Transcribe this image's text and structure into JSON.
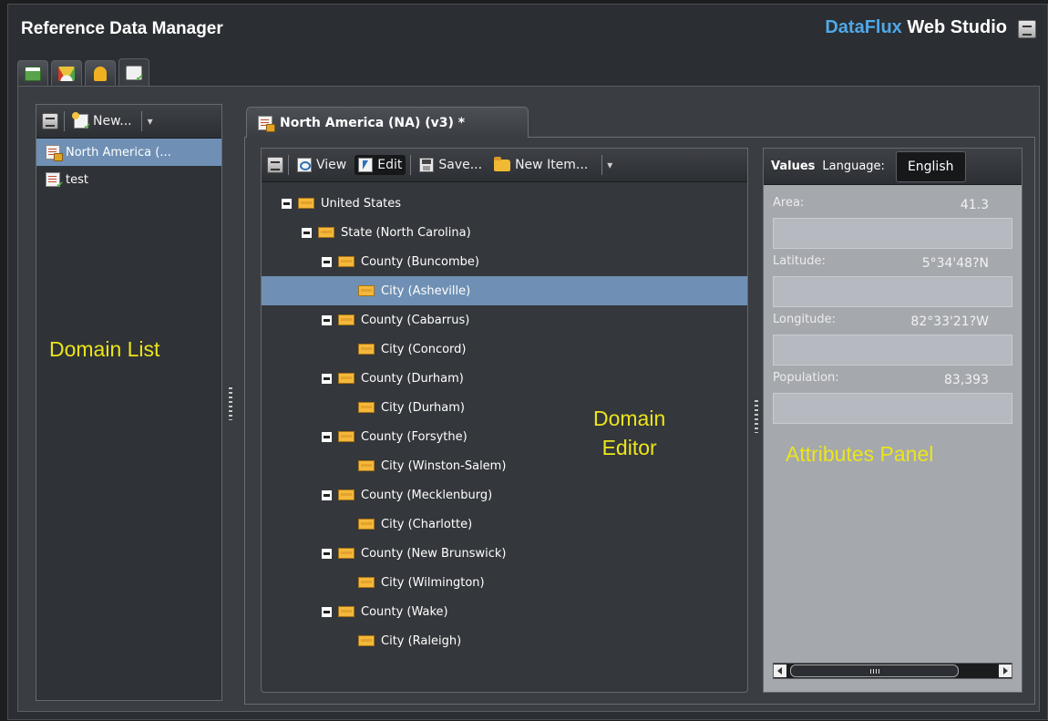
{
  "app": {
    "title": "Reference Data Manager",
    "brand_part1": "DataFlux",
    "brand_part2": "Web Studio",
    "tabs": [
      "window-icon",
      "gauge-icon",
      "bell-icon",
      "domain-doc-icon"
    ],
    "active_tab": 3
  },
  "domain_list": {
    "new_label": "New...",
    "items": [
      {
        "label": "North America (...",
        "icon": "locked-domain-icon",
        "selected": true
      },
      {
        "label": "test",
        "icon": "domain-icon",
        "selected": false
      }
    ],
    "annotation": "Domain List"
  },
  "domain_tab": {
    "title": "North America (NA) (v3) *"
  },
  "editor": {
    "toolbar": {
      "view_label": "View",
      "edit_label": "Edit",
      "save_label": "Save...",
      "new_item_label": "New Item..."
    },
    "annotation_line1": "Domain",
    "annotation_line2": "Editor",
    "tree": [
      {
        "label": "United States",
        "level": 0,
        "expanded": true
      },
      {
        "label": "State (North Carolina)",
        "level": 1,
        "expanded": true
      },
      {
        "label": "County (Buncombe)",
        "level": 2,
        "expanded": true
      },
      {
        "label": "City (Asheville)",
        "level": 3,
        "selected": true
      },
      {
        "label": "County (Cabarrus)",
        "level": 2,
        "expanded": true
      },
      {
        "label": "City (Concord)",
        "level": 3
      },
      {
        "label": "County (Durham)",
        "level": 2,
        "expanded": true
      },
      {
        "label": "City (Durham)",
        "level": 3
      },
      {
        "label": "County (Forsythe)",
        "level": 2,
        "expanded": true
      },
      {
        "label": "City (Winston-Salem)",
        "level": 3
      },
      {
        "label": "County (Mecklenburg)",
        "level": 2,
        "expanded": true
      },
      {
        "label": "City (Charlotte)",
        "level": 3
      },
      {
        "label": "County (New Brunswick)",
        "level": 2,
        "expanded": true
      },
      {
        "label": "City (Wilmington)",
        "level": 3
      },
      {
        "label": "County (Wake)",
        "level": 2,
        "expanded": true
      },
      {
        "label": "City (Raleigh)",
        "level": 3
      }
    ]
  },
  "attributes": {
    "tab_label": "Values",
    "language_label": "Language:",
    "language_value": "English",
    "fields": [
      {
        "label": "Area:",
        "value": "41.3"
      },
      {
        "label": "Latitude:",
        "value": "5°34'48?N"
      },
      {
        "label": "Longitude:",
        "value": "82°33'21?W"
      },
      {
        "label": "Population:",
        "value": "83,393"
      }
    ],
    "annotation": "Attributes Panel"
  }
}
